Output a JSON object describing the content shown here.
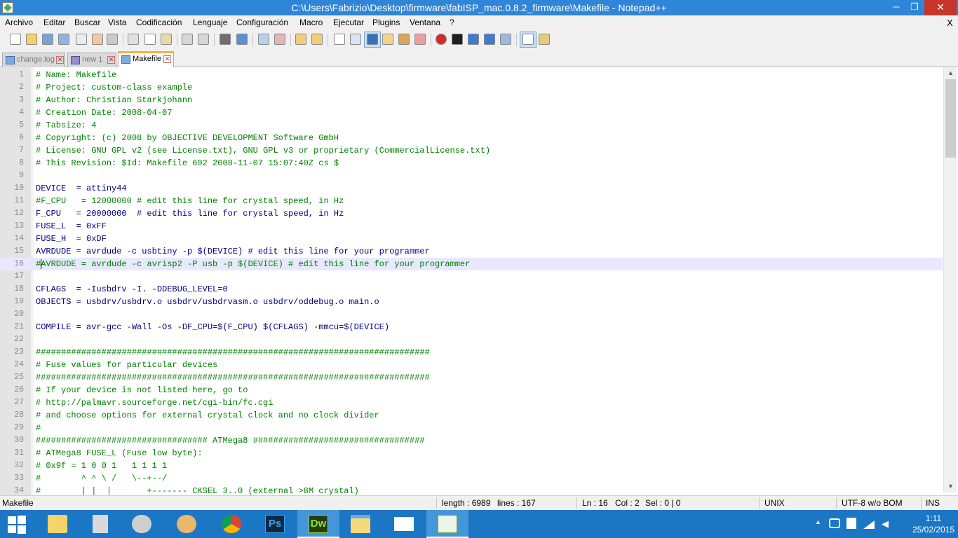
{
  "window": {
    "title": "C:\\Users\\Fabrizio\\Desktop\\firmware\\fabISP_mac.0.8.2_firmware\\Makefile - Notepad++",
    "minimize_glyph": "─",
    "maximize_glyph": "❐",
    "close_glyph": "✕"
  },
  "menu": {
    "items": [
      "Archivo",
      "Editar",
      "Buscar",
      "Vista",
      "Codificación",
      "Lenguaje",
      "Configuración",
      "Macro",
      "Ejecutar",
      "Plugins",
      "Ventana",
      "?"
    ],
    "close_glyph": "X"
  },
  "toolbar": {
    "buttons": [
      "new-file",
      "open-file",
      "save",
      "save-all",
      "close",
      "close-all",
      "print",
      "cut",
      "copy",
      "paste",
      "undo",
      "redo",
      "find",
      "replace",
      "zoom-in",
      "zoom-out",
      "sync-vertical",
      "sync-horizontal",
      "word-wrap",
      "show-all-chars",
      "indent-guide",
      "user-defined-language",
      "document-map",
      "function-list",
      "record-macro",
      "stop-recording",
      "play-macro",
      "run-macro-multiple",
      "save-macro",
      "spell-check",
      "spell-check-options"
    ]
  },
  "tabs": [
    {
      "label": "change.log",
      "active": false
    },
    {
      "label": "new   1",
      "active": false
    },
    {
      "label": "Makefile",
      "active": true
    }
  ],
  "editor": {
    "current_line": 16,
    "lines": [
      {
        "n": "1",
        "text": "# Name: Makefile",
        "kind": "comment"
      },
      {
        "n": "2",
        "text": "# Project: custom-class example",
        "kind": "comment"
      },
      {
        "n": "3",
        "text": "# Author: Christian Starkjohann",
        "kind": "comment"
      },
      {
        "n": "4",
        "text": "# Creation Date: 2008-04-07",
        "kind": "comment"
      },
      {
        "n": "5",
        "text": "# Tabsize: 4",
        "kind": "comment"
      },
      {
        "n": "6",
        "text": "# Copyright: (c) 2008 by OBJECTIVE DEVELOPMENT Software GmbH",
        "kind": "comment"
      },
      {
        "n": "7",
        "text": "# License: GNU GPL v2 (see License.txt), GNU GPL v3 or proprietary (CommercialLicense.txt)",
        "kind": "comment"
      },
      {
        "n": "8",
        "text": "# This Revision: $Id: Makefile 692 2008-11-07 15:07:40Z cs $",
        "kind": "comment"
      },
      {
        "n": "9",
        "text": "",
        "kind": "blank"
      },
      {
        "n": "10",
        "text": "DEVICE  = attiny44",
        "kind": "assign"
      },
      {
        "n": "11",
        "text": "#F_CPU   = 12000000 # edit this line for crystal speed, in Hz",
        "kind": "comment"
      },
      {
        "n": "12",
        "text": "F_CPU   = 20000000  # edit this line for crystal speed, in Hz",
        "kind": "assign"
      },
      {
        "n": "13",
        "text": "FUSE_L  = 0xFF",
        "kind": "assign"
      },
      {
        "n": "14",
        "text": "FUSE_H  = 0xDF",
        "kind": "assign"
      },
      {
        "n": "15",
        "text": "AVRDUDE = avrdude -c usbtiny -p $(DEVICE) # edit this line for your programmer",
        "kind": "assign"
      },
      {
        "n": "16",
        "text": "#AVRDUDE = avrdude -c avrisp2 -P usb -p $(DEVICE) # edit this line for your programmer",
        "kind": "comment"
      },
      {
        "n": "17",
        "text": "",
        "kind": "blank"
      },
      {
        "n": "18",
        "text": "CFLAGS  = -Iusbdrv -I. -DDEBUG_LEVEL=0",
        "kind": "assign"
      },
      {
        "n": "19",
        "text": "OBJECTS = usbdrv/usbdrv.o usbdrv/usbdrvasm.o usbdrv/oddebug.o main.o",
        "kind": "assign"
      },
      {
        "n": "20",
        "text": "",
        "kind": "blank"
      },
      {
        "n": "21",
        "text": "COMPILE = avr-gcc -Wall -Os -DF_CPU=$(F_CPU) $(CFLAGS) -mmcu=$(DEVICE)",
        "kind": "assign"
      },
      {
        "n": "22",
        "text": "",
        "kind": "blank"
      },
      {
        "n": "23",
        "text": "##############################################################################",
        "kind": "comment"
      },
      {
        "n": "24",
        "text": "# Fuse values for particular devices",
        "kind": "comment"
      },
      {
        "n": "25",
        "text": "##############################################################################",
        "kind": "comment"
      },
      {
        "n": "26",
        "text": "# If your device is not listed here, go to",
        "kind": "comment"
      },
      {
        "n": "27",
        "text": "# http://palmavr.sourceforge.net/cgi-bin/fc.cgi",
        "kind": "comment"
      },
      {
        "n": "28",
        "text": "# and choose options for external crystal clock and no clock divider",
        "kind": "comment"
      },
      {
        "n": "29",
        "text": "#",
        "kind": "comment"
      },
      {
        "n": "30",
        "text": "################################## ATMega8 ##################################",
        "kind": "comment"
      },
      {
        "n": "31",
        "text": "# ATMega8 FUSE_L (Fuse low byte):",
        "kind": "comment"
      },
      {
        "n": "32",
        "text": "# 0x9f = 1 0 0 1   1 1 1 1",
        "kind": "comment"
      },
      {
        "n": "33",
        "text": "#        ^ ^ \\ /   \\--+--/",
        "kind": "comment"
      },
      {
        "n": "34",
        "text": "#        | |  |       +------- CKSEL 3..0 (external >8M crystal)",
        "kind": "comment"
      }
    ]
  },
  "status": {
    "file_type": "Makefile",
    "length": "length : 6989",
    "lines": "lines : 167",
    "ln": "Ln : 16",
    "col": "Col : 2",
    "sel": "Sel : 0 | 0",
    "eol": "UNIX",
    "encoding": "UTF-8 w/o BOM",
    "mode": "INS"
  },
  "taskbar": {
    "apps": [
      "file-explorer-folder",
      "calculator",
      "paint-tool",
      "paint-palette",
      "chrome",
      "photoshop",
      "dreamweaver",
      "file-explorer",
      "mail",
      "notepad-plus-plus"
    ],
    "ps_label": "Ps",
    "dw_label": "Dw",
    "time": "1:11",
    "date": "25/02/2015"
  },
  "colors": {
    "title_bar": "#2f86d9",
    "close_button": "#c7362a",
    "comment_text": "#008000",
    "assign_text": "#000080",
    "current_line_bg": "#e8e8ff",
    "taskbar": "#1b76c4",
    "active_tab_accent": "#fab042"
  }
}
